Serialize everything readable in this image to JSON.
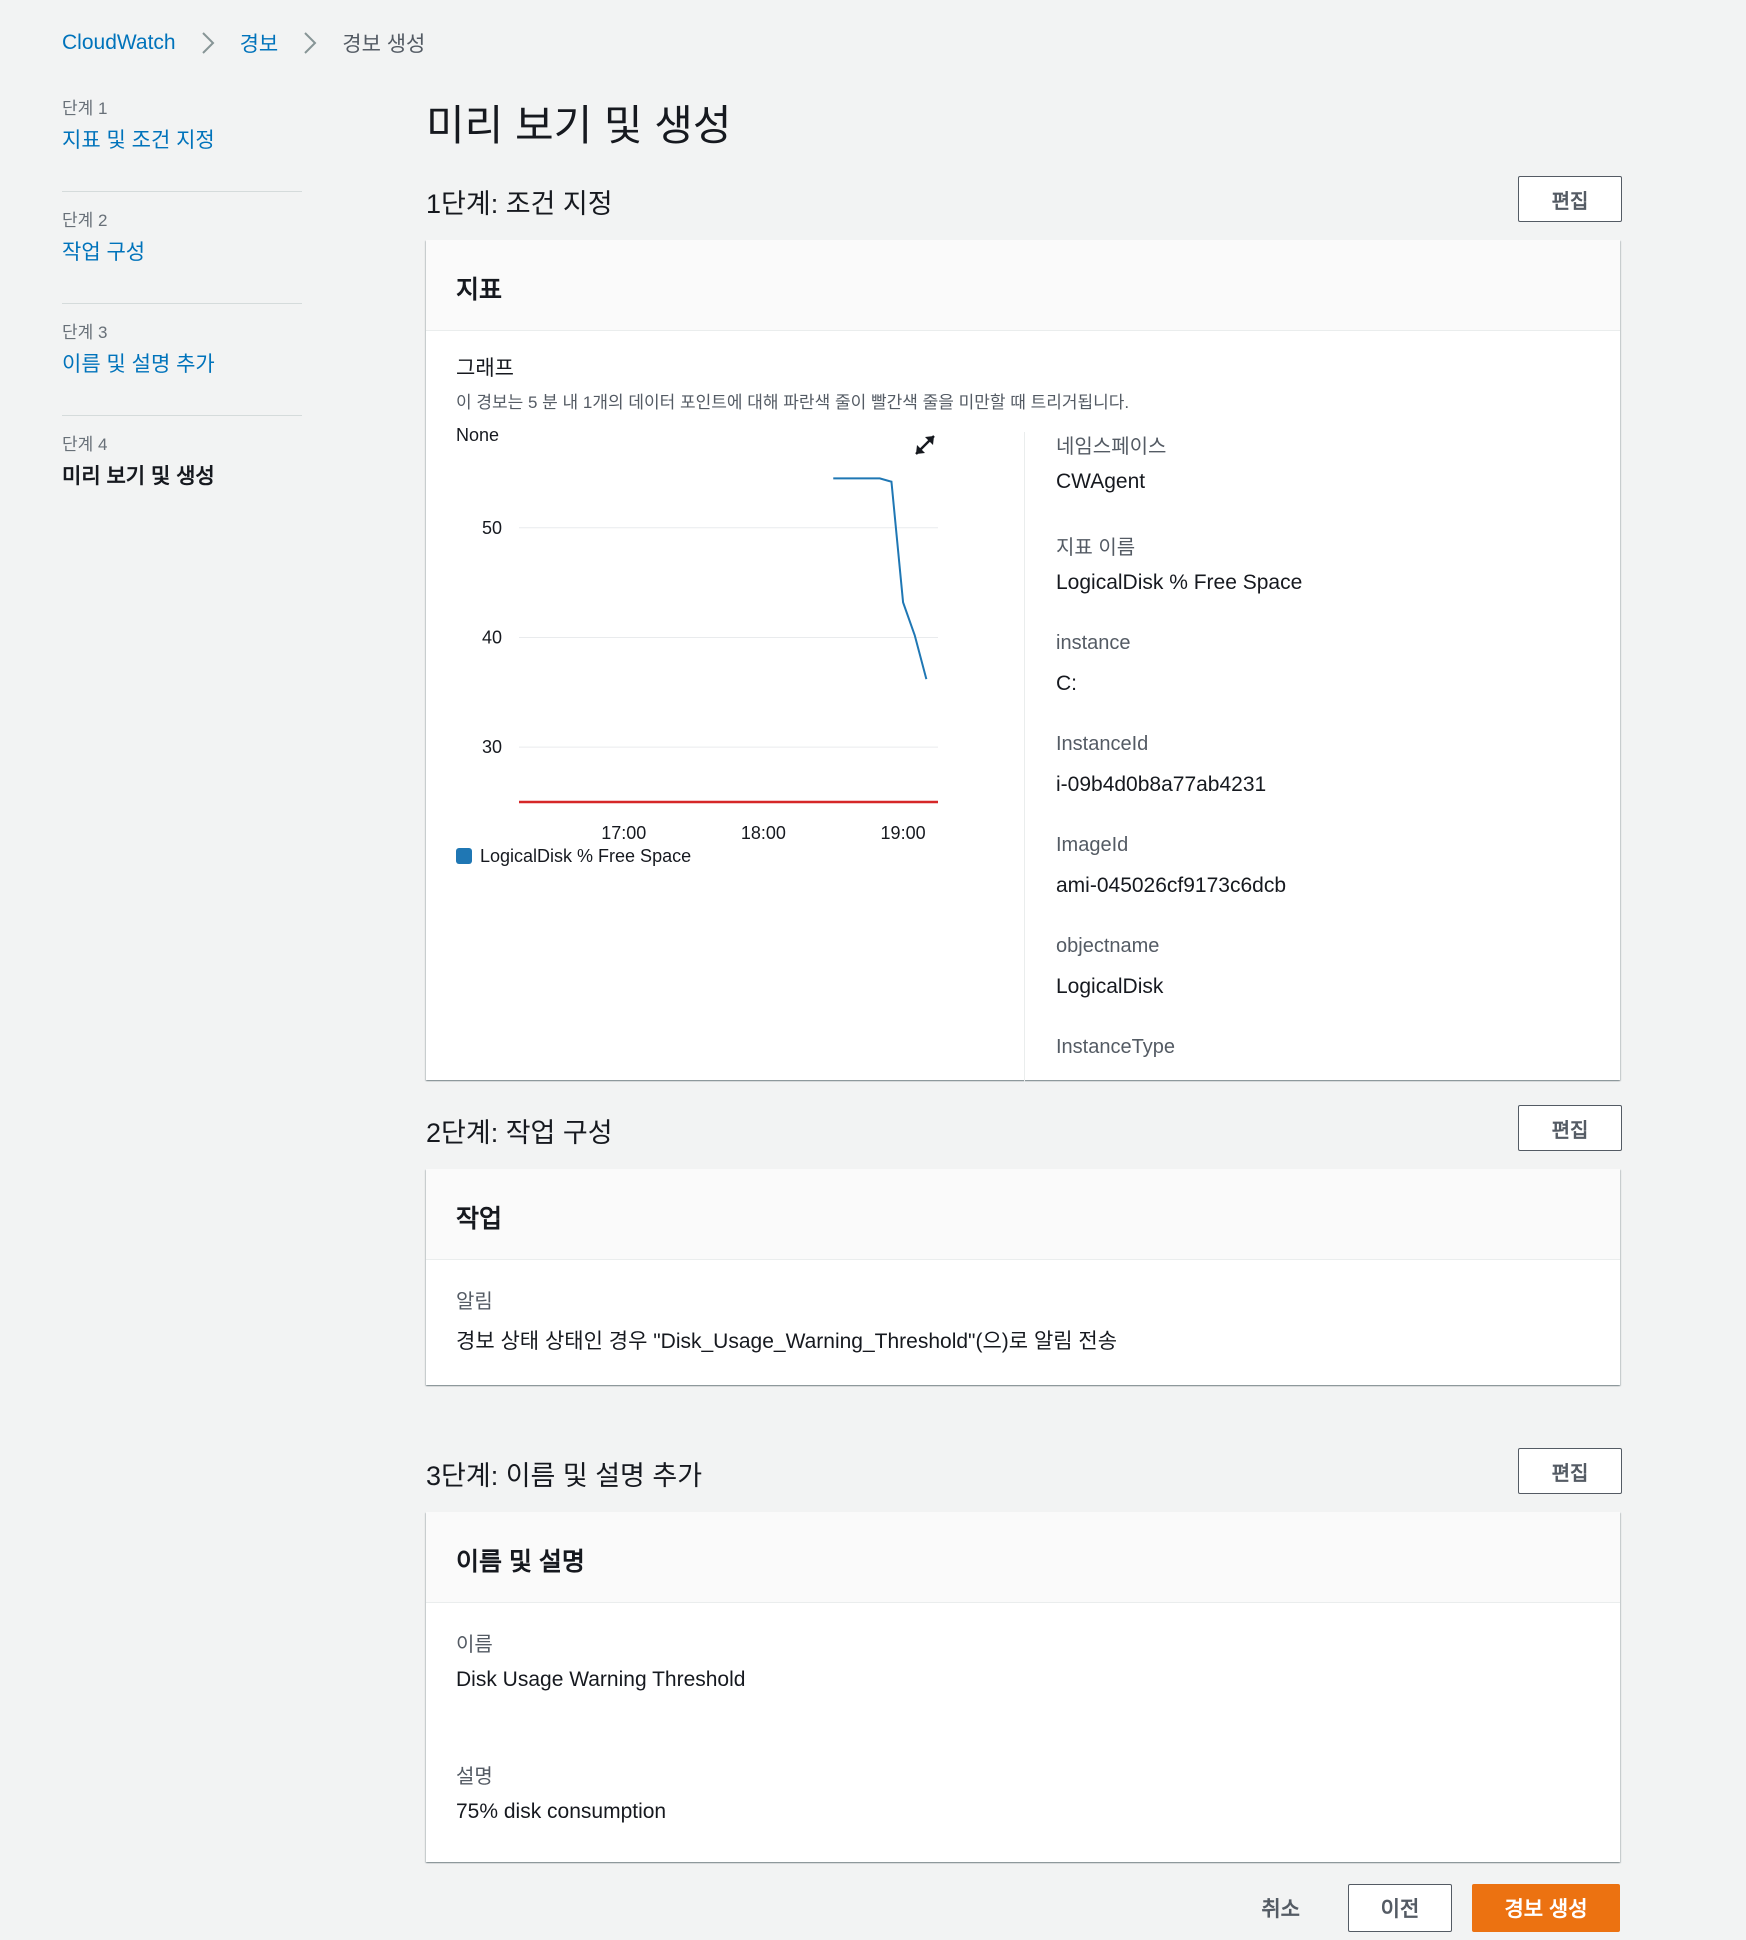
{
  "breadcrumb": {
    "items": [
      "CloudWatch",
      "경보",
      "경보 생성"
    ]
  },
  "steps": [
    {
      "num": "단계 1",
      "label": "지표 및 조건 지정",
      "active": false
    },
    {
      "num": "단계 2",
      "label": "작업 구성",
      "active": false
    },
    {
      "num": "단계 3",
      "label": "이름 및 설명 추가",
      "active": false
    },
    {
      "num": "단계 4",
      "label": "미리 보기 및 생성",
      "active": true
    }
  ],
  "page_title": "미리 보기 및 생성",
  "edit_label": "편집",
  "section1": {
    "title": "1단계: 조건 지정",
    "card_title": "지표",
    "graph_title": "그래프",
    "graph_desc": "이 경보는 5 분 내 1개의 데이터 포인트에 대해 파란색 줄이 빨간색 줄을 미만할 때 트리거됩니다.",
    "metrics": [
      {
        "label": "네임스페이스",
        "value": "CWAgent"
      },
      {
        "label": "지표 이름",
        "value": "LogicalDisk % Free Space"
      },
      {
        "label": "instance",
        "value": "C:"
      },
      {
        "label": "InstanceId",
        "value": "i-09b4d0b8a77ab4231"
      },
      {
        "label": "ImageId",
        "value": "ami-045026cf9173c6dcb"
      },
      {
        "label": "objectname",
        "value": "LogicalDisk"
      },
      {
        "label": "InstanceType",
        "value": ""
      }
    ]
  },
  "chart_data": {
    "type": "line",
    "ylabel": "None",
    "y_ticks": [
      30,
      40,
      50
    ],
    "x_ticks": [
      "17:00",
      "18:00",
      "19:00"
    ],
    "xlim": [
      "16:15",
      "19:15"
    ],
    "ylim": [
      25,
      58
    ],
    "grid": true,
    "legend_position": "bottom-left",
    "series": [
      {
        "name": "LogicalDisk % Free Space",
        "color": "#1f77b4",
        "x": [
          "18:30",
          "18:50",
          "18:55",
          "19:00",
          "19:05",
          "19:10"
        ],
        "y": [
          54.5,
          54.5,
          54.2,
          43.2,
          40.2,
          36.2
        ]
      },
      {
        "name": "threshold",
        "color": "#d62728",
        "x": [
          "16:15",
          "19:15"
        ],
        "y": [
          25,
          25
        ]
      }
    ]
  },
  "section2": {
    "title": "2단계: 작업 구성",
    "card_title": "작업",
    "label": "알림",
    "value": "경보 상태 상태인 경우 \"Disk_Usage_Warning_Threshold\"(으)로 알림 전송"
  },
  "section3": {
    "title": "3단계: 이름 및 설명 추가",
    "card_title": "이름 및 설명",
    "name_label": "이름",
    "name_value": "Disk Usage Warning Threshold",
    "desc_label": "설명",
    "desc_value": "75% disk consumption"
  },
  "footer": {
    "cancel": "취소",
    "prev": "이전",
    "create": "경보 생성"
  }
}
